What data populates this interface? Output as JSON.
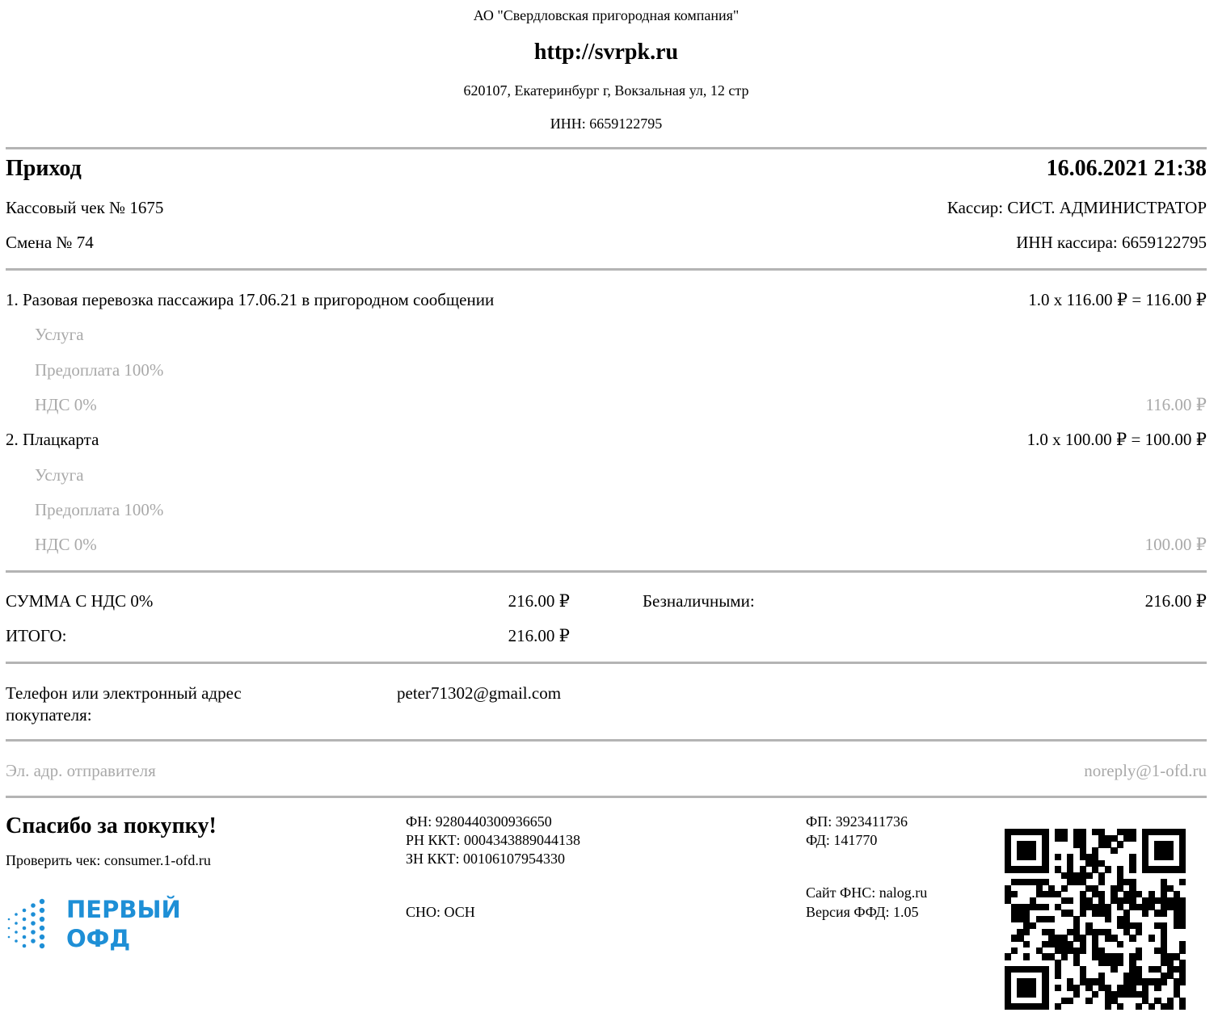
{
  "header": {
    "company": "АО \"Свердловская пригородная компания\"",
    "site": "http://svrpk.ru",
    "address": "620107, Екатеринбург г, Вокзальная ул, 12 стр",
    "inn": "ИНН: 6659122795"
  },
  "receipt": {
    "type": "Приход",
    "datetime": "16.06.2021 21:38",
    "number": "Кассовый чек № 1675",
    "cashier": "Кассир: СИСТ. АДМИНИСТРАТОР",
    "shift": "Смена № 74",
    "cashier_inn": "ИНН кассира: 6659122795"
  },
  "items": [
    {
      "name": "1. Разовая перевозка пассажира 17.06.21 в пригородном сообщении",
      "calc": "1.0 x 116.00 ₽ = 116.00 ₽",
      "kind": "Услуга",
      "payment": "Предоплата 100%",
      "vat": "НДС 0%",
      "vat_amount": "116.00 ₽"
    },
    {
      "name": "2. Плацкарта",
      "calc": "1.0 x 100.00 ₽ = 100.00 ₽",
      "kind": "Услуга",
      "payment": "Предоплата 100%",
      "vat": "НДС 0%",
      "vat_amount": "100.00 ₽"
    }
  ],
  "totals": {
    "vat_label": "СУММА С НДС 0%",
    "vat_value": "216.00 ₽",
    "total_label": "ИТОГО:",
    "total_value": "216.00 ₽",
    "cashless_label": "Безналичными:",
    "cashless_value": "216.00 ₽"
  },
  "buyer": {
    "label_line1": "Телефон или электронный адрес",
    "label_line2": "покупателя:",
    "value": "peter71302@gmail.com"
  },
  "sender": {
    "label": "Эл. адр. отправителя",
    "value": "noreply@1-ofd.ru"
  },
  "footer": {
    "thanks": "Спасибо за покупку!",
    "check": "Проверить чек: consumer.1-ofd.ru",
    "logo_line1": "ПЕРВЫЙ",
    "logo_line2": "ОФД",
    "logo_color": "#1e8fd6",
    "fn": "ФН: 9280440300936650",
    "rn": "РН ККТ: 0004343889044138",
    "zn": "ЗН ККТ: 00106107954330",
    "sno": "СНО: ОСН",
    "fp": "ФП: 3923411736",
    "fd": "ФД: 141770",
    "fns_site": "Сайт ФНС: nalog.ru",
    "ffd": "Версия ФФД: 1.05"
  }
}
